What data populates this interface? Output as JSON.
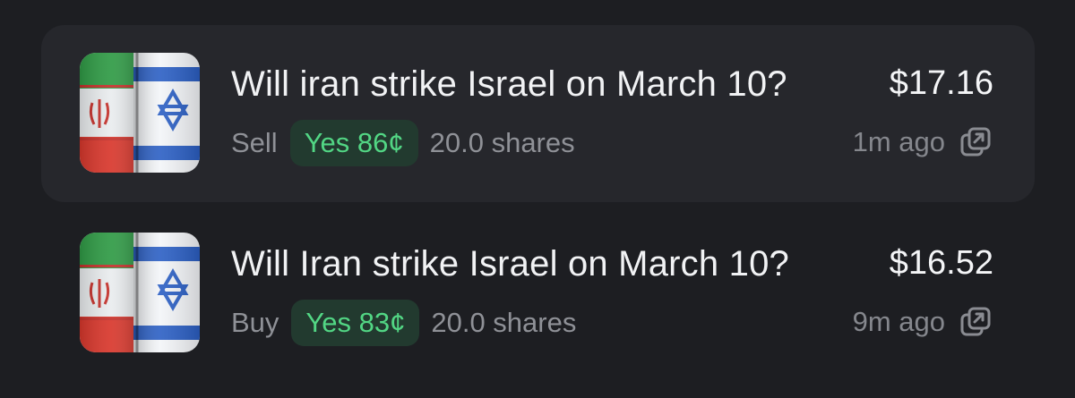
{
  "activity": [
    {
      "title": "Will iran strike Israel on March 10?",
      "side": "Sell",
      "outcome": "Yes 86¢",
      "shares": "20.0 shares",
      "amount": "$17.16",
      "time": "1m ago",
      "icon": "external-link-icon"
    },
    {
      "title": "Will Iran strike Israel on March 10?",
      "side": "Buy",
      "outcome": "Yes 83¢",
      "shares": "20.0 shares",
      "amount": "$16.52",
      "time": "9m ago",
      "icon": "external-link-icon"
    }
  ],
  "colors": {
    "background": "#1d1e22",
    "row_highlight": "#26272c",
    "pill_bg": "#223a2f",
    "pill_text": "#52d684"
  }
}
